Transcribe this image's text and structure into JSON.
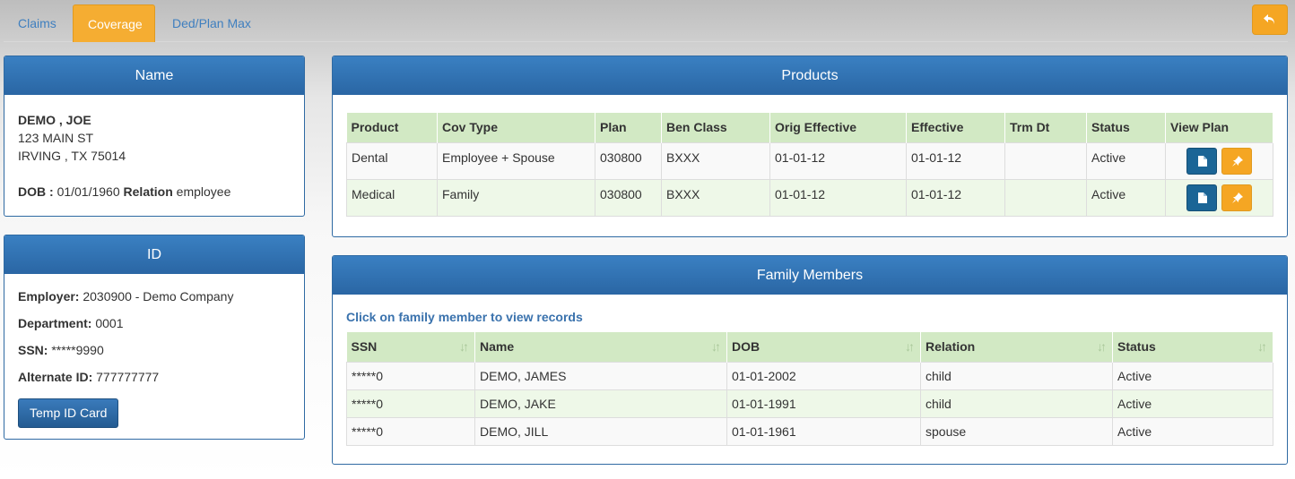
{
  "tabs": [
    {
      "label": "Claims",
      "active": false
    },
    {
      "label": "Coverage",
      "active": true
    },
    {
      "label": "Ded/Plan Max",
      "active": false
    }
  ],
  "back_button": {
    "icon": "undo-arrow-icon"
  },
  "name_panel": {
    "title": "Name",
    "name": "DEMO , JOE",
    "address1": "123 MAIN ST",
    "address2": "IRVING , TX 75014",
    "dob_label": "DOB :",
    "dob_value": "01/01/1960",
    "relation_label": "Relation",
    "relation_value": "employee"
  },
  "id_panel": {
    "title": "ID",
    "employer_label": "Employer:",
    "employer_value": "2030900 - Demo Company",
    "department_label": "Department:",
    "department_value": "0001",
    "ssn_label": "SSN:",
    "ssn_value": "*****9990",
    "alt_id_label": "Alternate ID:",
    "alt_id_value": "777777777",
    "temp_card_label": "Temp ID Card"
  },
  "products_panel": {
    "title": "Products",
    "columns": [
      "Product",
      "Cov Type",
      "Plan",
      "Ben Class",
      "Orig Effective",
      "Effective",
      "Trm Dt",
      "Status",
      "View Plan"
    ],
    "rows": [
      [
        "Dental",
        "Employee + Spouse",
        "030800",
        "BXXX",
        "01-01-12",
        "01-01-12",
        "",
        "Active"
      ],
      [
        "Medical",
        "Family",
        "030800",
        "BXXX",
        "01-01-12",
        "01-01-12",
        "",
        "Active"
      ]
    ]
  },
  "family_panel": {
    "title": "Family Members",
    "hint": "Click on family member to view records",
    "columns": [
      "SSN",
      "Name",
      "DOB",
      "Relation",
      "Status"
    ],
    "rows": [
      [
        "*****0",
        "DEMO, JAMES",
        "01-01-2002",
        "child",
        "Active"
      ],
      [
        "*****0",
        "DEMO, JAKE",
        "01-01-1991",
        "child",
        "Active"
      ],
      [
        "*****0",
        "DEMO, JILL",
        "01-01-1961",
        "spouse",
        "Active"
      ]
    ]
  },
  "colors": {
    "accent": "#f5a623",
    "header_blue": "#2f6aa3",
    "table_header": "#d2e9c4"
  }
}
